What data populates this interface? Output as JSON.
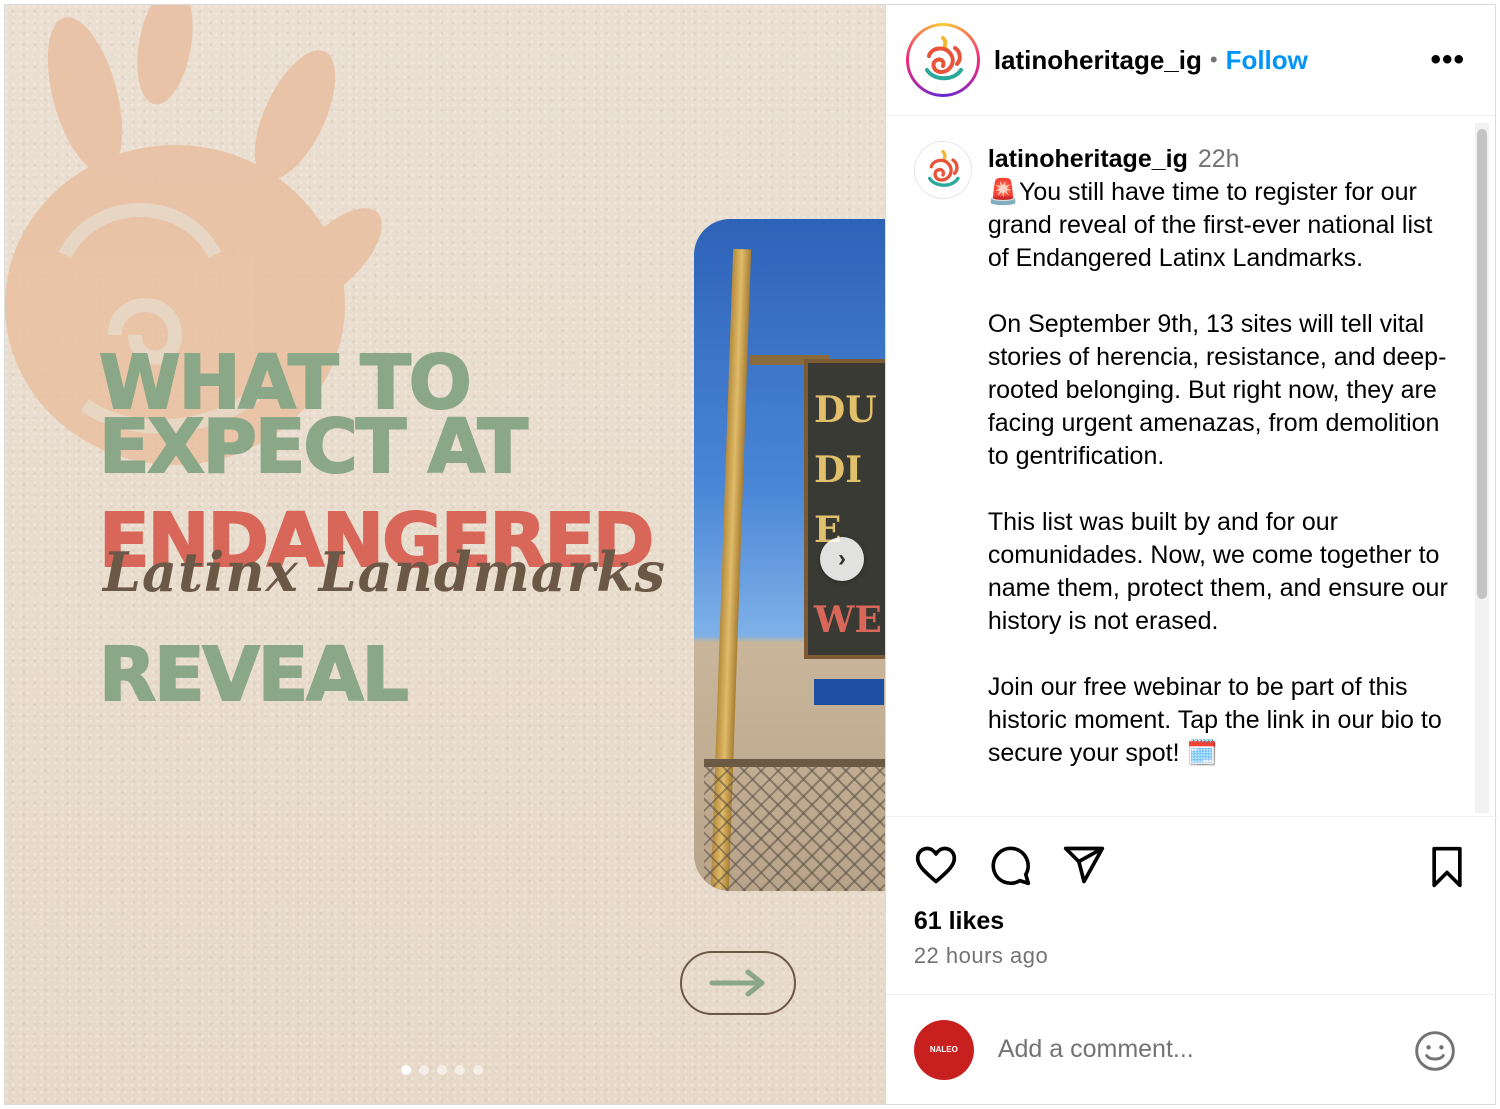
{
  "post": {
    "image": {
      "headline_line1": "WHAT TO",
      "headline_line2": "EXPECT AT",
      "headline_line3": "ENDANGERED",
      "headline_script": "Latinx Landmarks",
      "headline_line4": "REVEAL",
      "photo_sign_letters": [
        "DU",
        "DI",
        "E",
        "WE"
      ],
      "carousel_dots": 5,
      "active_dot": 0,
      "colors": {
        "green": "#8aa787",
        "red": "#d8675a",
        "brown": "#6b5847",
        "background": "#e8dccd"
      }
    }
  },
  "header": {
    "username": "latinoheritage_ig",
    "separator": "•",
    "follow_label": "Follow",
    "more_label": "•••"
  },
  "caption": {
    "username": "latinoheritage_ig",
    "time": "22h",
    "paragraphs": [
      "🚨You still have time to register for our grand reveal of the first-ever national list of Endangered Latinx Landmarks.",
      "On September 9th, 13 sites will tell vital stories of herencia, resistance, and deep-rooted belonging. But right now, they are facing urgent amenazas, from demolition to gentrification.",
      "This list was built by and for our comunidades. Now, we come together to name them, protect them, and ensure our history is not erased.",
      "Join our free webinar to be part of this historic moment. Tap the link in our bio to secure your spot! 🗓️"
    ]
  },
  "actions": {
    "likes": "61 likes",
    "time_ago": "22 hours ago"
  },
  "comment": {
    "placeholder": "Add a comment...",
    "avatar_text": "NALEO"
  }
}
